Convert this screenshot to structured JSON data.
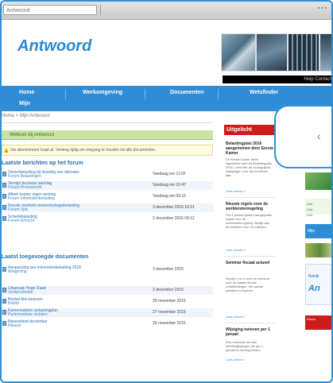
{
  "browser": {
    "url": "Antwoord",
    "controls": "▪ ▪ ▪"
  },
  "site": {
    "logo": "Antwoord"
  },
  "topbar_links": "Help Contact",
  "nav": {
    "items": [
      "Home",
      "Werkomgeving",
      "Documenten",
      "Wetsfinder"
    ],
    "second_row": "Mijn"
  },
  "breadcrumb": "Home > Mijn Antwoord",
  "main": {
    "welcome": "Welkom bij Antwoord",
    "notice": "Uw abonnement loopt af. Verleng tijdig om toegang te houden tot alle documenten.",
    "section1_title": "Laatste berichten op het forum",
    "forum_rows": [
      {
        "title": "Omzetbelasting bij levering van diensten",
        "sub": "Forum Belastingen",
        "date": "Vandaag om 11:02"
      },
      {
        "title": "Termijn bezwaar aanslag",
        "sub": "Forum Procesrecht",
        "date": "Vandaag om 10:47"
      },
      {
        "title": "Aftrek kosten eigen woning",
        "sub": "Forum Inkomstenbelasting",
        "date": "Vandaag om 09:15"
      },
      {
        "title": "Fiscale eenheid vennootschapsbelasting",
        "sub": "Forum Vpb",
        "date": "3 december 2015 16:21"
      },
      {
        "title": "Schenkbelasting",
        "sub": "Forum Erfrecht",
        "date": "2 december 2015 09:12"
      }
    ],
    "section2_title": "Laatst toegevoegde documenten",
    "doc_rows": [
      {
        "title": "Aanpassing wet inkomstenbelasting 2016",
        "sub": "Wetgeving",
        "date": "3 december 2015"
      },
      {
        "title": "Uitspraak Hoge Raad",
        "sub": "Jurisprudentie",
        "date": "2 december 2015"
      },
      {
        "title": "Besluit btw-tarieven",
        "sub": "Beleid",
        "date": "30 november 2015"
      },
      {
        "title": "Kamerstukken belastingplan",
        "sub": "Parlementaire stukken",
        "date": "27 november 2015"
      },
      {
        "title": "Nieuwsbrief december",
        "sub": "Nieuws",
        "date": "26 november 2015"
      }
    ]
  },
  "news": {
    "heading": "Uitgelicht",
    "items": [
      {
        "title": "Belastingplan 2016 aangenomen door Eerste Kamer",
        "body": "De Eerste Kamer heeft ingestemd met het Belastingplan 2016. Lees hier de belangrijkste wijzigingen voor het komende jaar.",
        "more": "Lees verder »"
      },
      {
        "title": "Nieuwe regels voor de werkkostenregeling",
        "body": "Per 1 januari gelden aangepaste regels voor de werkkostenregeling. Bekijk wat dit betekent voor uw cliënten.",
        "more": "Lees verder »"
      },
      {
        "title": "Seminar fiscaal actueel",
        "body": "Schrijf u nu in voor het seminar over de laatste fiscale ontwikkelingen. Het aantal plaatsen is beperkt.",
        "more": "Lees verder »"
      },
      {
        "title": "Wijziging tarieven per 1 januari",
        "body": "Een overzicht van alle tariefswijzigingen die per 1 januari in werking treden.",
        "more": "Lees verder »"
      }
    ]
  },
  "far_right": {
    "blue_label": "Mijn",
    "ad_small": "Bekijk",
    "ad_brand": "An",
    "red_text": "Nieuw",
    "links": [
      "Link",
      "Link",
      "Link"
    ]
  }
}
